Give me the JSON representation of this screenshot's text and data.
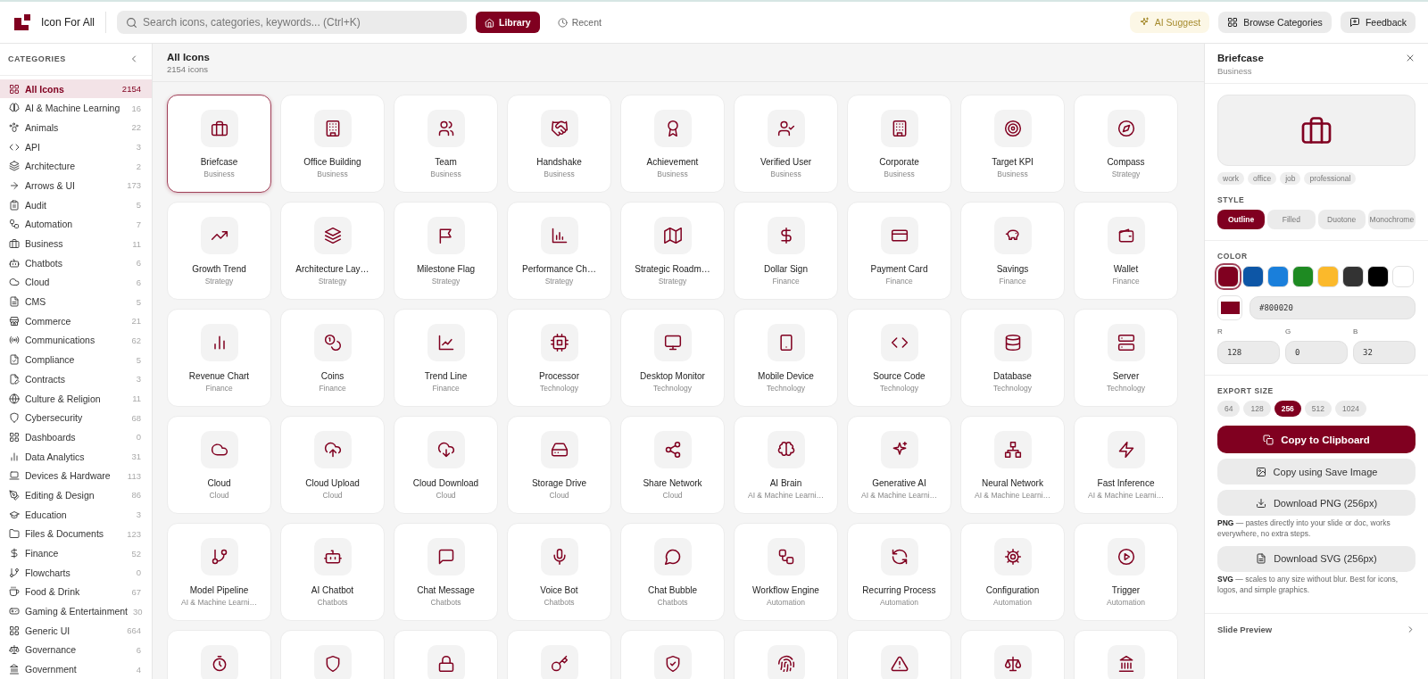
{
  "topbar": {
    "brand": "Icon For All",
    "search": {
      "placeholder": "Search icons, categories, keywords... (Ctrl+K)"
    },
    "nav": [
      {
        "label": "Library",
        "selected": true
      },
      {
        "label": "Recent",
        "selected": false
      }
    ],
    "actions": [
      {
        "label": "AI Suggest",
        "kind": "highlight"
      },
      {
        "label": "Browse Categories",
        "kind": "plain"
      },
      {
        "label": "Feedback",
        "kind": "plain"
      }
    ]
  },
  "sidebar": {
    "title": "CATEGORIES",
    "items": [
      {
        "label": "All Icons",
        "count": "2154",
        "selected": true
      },
      {
        "label": "AI & Machine Learning",
        "count": "16",
        "selected": false
      },
      {
        "label": "Animals",
        "count": "22",
        "selected": false
      },
      {
        "label": "API",
        "count": "3",
        "selected": false
      },
      {
        "label": "Architecture",
        "count": "2",
        "selected": false
      },
      {
        "label": "Arrows & UI",
        "count": "173",
        "selected": false
      },
      {
        "label": "Audit",
        "count": "5",
        "selected": false
      },
      {
        "label": "Automation",
        "count": "7",
        "selected": false
      },
      {
        "label": "Business",
        "count": "11",
        "selected": false
      },
      {
        "label": "Chatbots",
        "count": "6",
        "selected": false
      },
      {
        "label": "Cloud",
        "count": "6",
        "selected": false
      },
      {
        "label": "CMS",
        "count": "5",
        "selected": false
      },
      {
        "label": "Commerce",
        "count": "21",
        "selected": false
      },
      {
        "label": "Communications",
        "count": "62",
        "selected": false
      },
      {
        "label": "Compliance",
        "count": "5",
        "selected": false
      },
      {
        "label": "Contracts",
        "count": "3",
        "selected": false
      },
      {
        "label": "Culture & Religion",
        "count": "11",
        "selected": false
      },
      {
        "label": "Cybersecurity",
        "count": "68",
        "selected": false
      },
      {
        "label": "Dashboards",
        "count": "0",
        "selected": false
      },
      {
        "label": "Data Analytics",
        "count": "31",
        "selected": false
      },
      {
        "label": "Devices & Hardware",
        "count": "113",
        "selected": false
      },
      {
        "label": "Editing & Design",
        "count": "86",
        "selected": false
      },
      {
        "label": "Education",
        "count": "3",
        "selected": false
      },
      {
        "label": "Files & Documents",
        "count": "123",
        "selected": false
      },
      {
        "label": "Finance",
        "count": "52",
        "selected": false
      },
      {
        "label": "Flowcharts",
        "count": "0",
        "selected": false
      },
      {
        "label": "Food & Drink",
        "count": "67",
        "selected": false
      },
      {
        "label": "Gaming & Entertainment",
        "count": "30",
        "selected": false
      },
      {
        "label": "Generic UI",
        "count": "664",
        "selected": false
      },
      {
        "label": "Governance",
        "count": "6",
        "selected": false
      },
      {
        "label": "Government",
        "count": "4",
        "selected": false
      }
    ]
  },
  "main": {
    "title": "All Icons",
    "subtitle": "2154 icons",
    "icons": [
      {
        "name": "Briefcase",
        "category": "Business",
        "selected": true
      },
      {
        "name": "Office Building",
        "category": "Business",
        "selected": false
      },
      {
        "name": "Team",
        "category": "Business",
        "selected": false
      },
      {
        "name": "Handshake",
        "category": "Business",
        "selected": false
      },
      {
        "name": "Achievement",
        "category": "Business",
        "selected": false
      },
      {
        "name": "Verified User",
        "category": "Business",
        "selected": false
      },
      {
        "name": "Corporate",
        "category": "Business",
        "selected": false
      },
      {
        "name": "Target KPI",
        "category": "Business",
        "selected": false
      },
      {
        "name": "Compass",
        "category": "Strategy",
        "selected": false
      },
      {
        "name": "Growth Trend",
        "category": "Strategy",
        "selected": false
      },
      {
        "name": "Architecture Lay…",
        "category": "Strategy",
        "selected": false
      },
      {
        "name": "Milestone Flag",
        "category": "Strategy",
        "selected": false
      },
      {
        "name": "Performance Ch…",
        "category": "Strategy",
        "selected": false
      },
      {
        "name": "Strategic Roadm…",
        "category": "Strategy",
        "selected": false
      },
      {
        "name": "Dollar Sign",
        "category": "Finance",
        "selected": false
      },
      {
        "name": "Payment Card",
        "category": "Finance",
        "selected": false
      },
      {
        "name": "Savings",
        "category": "Finance",
        "selected": false
      },
      {
        "name": "Wallet",
        "category": "Finance",
        "selected": false
      },
      {
        "name": "Revenue Chart",
        "category": "Finance",
        "selected": false
      },
      {
        "name": "Coins",
        "category": "Finance",
        "selected": false
      },
      {
        "name": "Trend Line",
        "category": "Finance",
        "selected": false
      },
      {
        "name": "Processor",
        "category": "Technology",
        "selected": false
      },
      {
        "name": "Desktop Monitor",
        "category": "Technology",
        "selected": false
      },
      {
        "name": "Mobile Device",
        "category": "Technology",
        "selected": false
      },
      {
        "name": "Source Code",
        "category": "Technology",
        "selected": false
      },
      {
        "name": "Database",
        "category": "Technology",
        "selected": false
      },
      {
        "name": "Server",
        "category": "Technology",
        "selected": false
      },
      {
        "name": "Cloud",
        "category": "Cloud",
        "selected": false
      },
      {
        "name": "Cloud Upload",
        "category": "Cloud",
        "selected": false
      },
      {
        "name": "Cloud Download",
        "category": "Cloud",
        "selected": false
      },
      {
        "name": "Storage Drive",
        "category": "Cloud",
        "selected": false
      },
      {
        "name": "Share Network",
        "category": "Cloud",
        "selected": false
      },
      {
        "name": "AI Brain",
        "category": "AI & Machine Learni…",
        "selected": false
      },
      {
        "name": "Generative AI",
        "category": "AI & Machine Learni…",
        "selected": false
      },
      {
        "name": "Neural Network",
        "category": "AI & Machine Learni…",
        "selected": false
      },
      {
        "name": "Fast Inference",
        "category": "AI & Machine Learni…",
        "selected": false
      },
      {
        "name": "Model Pipeline",
        "category": "AI & Machine Learni…",
        "selected": false
      },
      {
        "name": "AI Chatbot",
        "category": "Chatbots",
        "selected": false
      },
      {
        "name": "Chat Message",
        "category": "Chatbots",
        "selected": false
      },
      {
        "name": "Voice Bot",
        "category": "Chatbots",
        "selected": false
      },
      {
        "name": "Chat Bubble",
        "category": "Chatbots",
        "selected": false
      },
      {
        "name": "Workflow Engine",
        "category": "Automation",
        "selected": false
      },
      {
        "name": "Recurring Process",
        "category": "Automation",
        "selected": false
      },
      {
        "name": "Configuration",
        "category": "Automation",
        "selected": false
      },
      {
        "name": "Trigger",
        "category": "Automation",
        "selected": false
      },
      {
        "selected": false
      },
      {
        "selected": false
      },
      {
        "selected": false
      },
      {
        "selected": false
      },
      {
        "selected": false
      },
      {
        "selected": false
      },
      {
        "selected": false
      },
      {
        "selected": false
      },
      {
        "selected": false
      }
    ]
  },
  "detail": {
    "name": "Briefcase",
    "category": "Business",
    "tags": [
      "work",
      "office",
      "job",
      "professional"
    ],
    "style_label": "STYLE",
    "styles": [
      {
        "label": "Outline",
        "selected": true
      },
      {
        "label": "Filled",
        "selected": false
      },
      {
        "label": "Duotone",
        "selected": false
      },
      {
        "label": "Monochrome",
        "selected": false
      }
    ],
    "color_label": "COLOR",
    "colors": [
      {
        "color": "#800020",
        "selected": true
      },
      {
        "color": "#0d56a6",
        "selected": false
      },
      {
        "color": "#1a7fdb",
        "selected": false
      },
      {
        "color": "#1e8a22",
        "selected": false
      },
      {
        "color": "#fbb92b",
        "selected": false
      },
      {
        "color": "#333333",
        "selected": false
      },
      {
        "color": "#000000",
        "selected": false
      },
      {
        "color": "#ffffff",
        "selected": false
      }
    ],
    "hex": "#800020",
    "channels": [
      {
        "label": "R",
        "value": "128"
      },
      {
        "label": "G",
        "value": "0"
      },
      {
        "label": "B",
        "value": "32"
      }
    ],
    "export_label": "EXPORT SIZE",
    "sizes": [
      {
        "label": "64",
        "selected": false
      },
      {
        "label": "128",
        "selected": false
      },
      {
        "label": "256",
        "selected": true
      },
      {
        "label": "512",
        "selected": false
      },
      {
        "label": "1024",
        "selected": false
      }
    ],
    "buttons": [
      {
        "label": "Copy to Clipboard",
        "kind": "primary"
      },
      {
        "label": "Copy using Save Image",
        "kind": "secondary"
      },
      {
        "label": "Download PNG (256px)",
        "kind": "secondary",
        "note": "**PNG** — pastes directly into your slide or doc, works everywhere, no extra steps."
      },
      {
        "label": "Download SVG (256px)",
        "kind": "secondary",
        "note": "**SVG** — scales to any size without blur. Best for icons, logos, and simple graphics."
      }
    ],
    "footer": "Slide Preview"
  }
}
